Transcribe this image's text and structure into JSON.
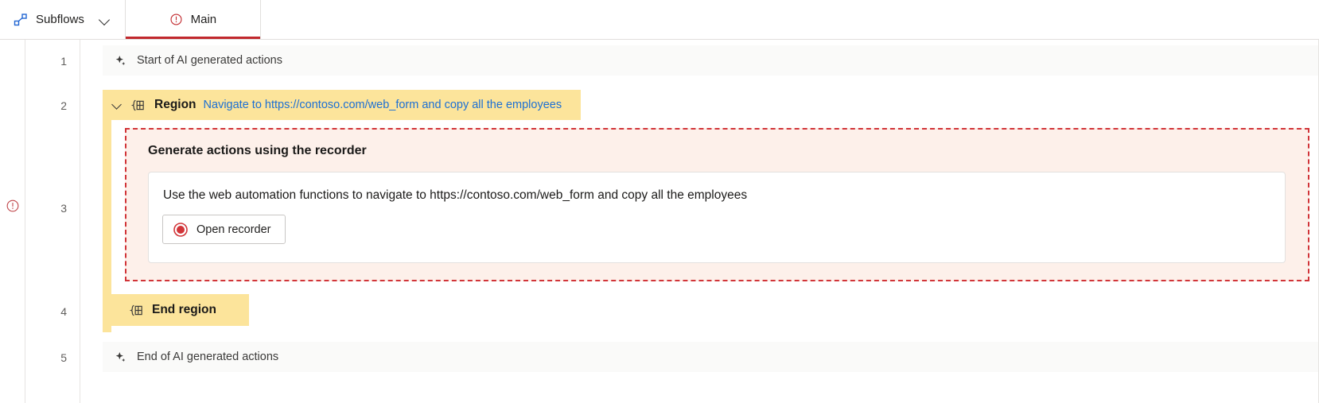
{
  "toolbar": {
    "subflows_label": "Subflows",
    "subflows_icon": "subflow-nodes-icon",
    "chevron_icon": "chevron-down-icon"
  },
  "tabs": [
    {
      "label": "Main",
      "icon": "error-circle-icon",
      "active": true,
      "accent_color": "#c1282d"
    }
  ],
  "gutter": {
    "line_numbers": [
      "1",
      "2",
      "3",
      "4",
      "5"
    ],
    "error_marker_icon": "error-circle-icon",
    "error_marker_row": 3
  },
  "rows": {
    "start_ai": {
      "label": "Start of AI generated actions",
      "icon": "ai-sparkle-icon"
    },
    "region": {
      "icon": "region-icon",
      "caret_icon": "chevron-down-icon",
      "title": "Region",
      "description": "Navigate to https://contoso.com/web_form and copy all the employees",
      "background_color": "#FCE49B",
      "description_color": "#1C6FD4"
    },
    "recorder_card": {
      "title": "Generate actions using the recorder",
      "prompt_text": "Use the web automation functions to navigate to https://contoso.com/web_form and copy all the employees",
      "button_label": "Open recorder",
      "button_icon": "record-circle-icon",
      "border_color": "#D13438",
      "background_color": "#FDF0EA"
    },
    "end_region": {
      "icon": "region-icon",
      "label": "End region",
      "background_color": "#FCE49B"
    },
    "end_ai": {
      "label": "End of AI generated actions",
      "icon": "ai-sparkle-icon"
    }
  }
}
